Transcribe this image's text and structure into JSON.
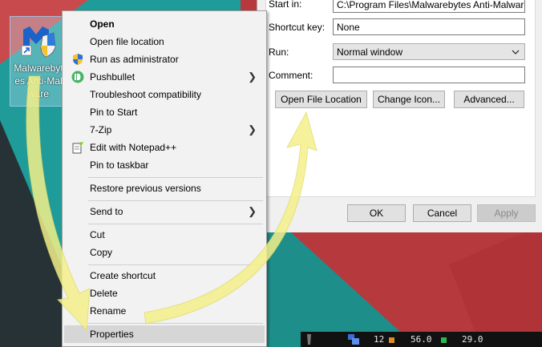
{
  "desktop_icon": {
    "label": "Malwarebytes Anti-Malware",
    "icon": "malwarebytes-shield-icon"
  },
  "context_menu": {
    "items": [
      {
        "label": "Open",
        "bold": true
      },
      {
        "label": "Open file location"
      },
      {
        "label": "Run as administrator",
        "icon": "uac-shield-icon"
      },
      {
        "label": "Pushbullet",
        "icon": "pushbullet-icon",
        "submenu": true
      },
      {
        "label": "Troubleshoot compatibility"
      },
      {
        "label": "Pin to Start"
      },
      {
        "label": "7-Zip",
        "submenu": true
      },
      {
        "label": "Edit with Notepad++",
        "icon": "notepad-plus-plus-icon"
      },
      {
        "label": "Pin to taskbar"
      },
      {
        "label": "Restore previous versions"
      },
      {
        "label": "Send to",
        "submenu": true
      },
      {
        "label": "Cut"
      },
      {
        "label": "Copy"
      },
      {
        "label": "Create shortcut"
      },
      {
        "label": "Delete"
      },
      {
        "label": "Rename"
      },
      {
        "label": "Properties",
        "highlighted": true
      }
    ]
  },
  "dialog": {
    "start_in_label": "Start in:",
    "start_in_value": "C:\\Program Files\\Malwarebytes Anti-Malware",
    "shortcut_key_label": "Shortcut key:",
    "shortcut_key_value": "None",
    "run_label": "Run:",
    "run_value": "Normal window",
    "comment_label": "Comment:",
    "comment_value": "",
    "open_file_location_button": "Open File Location",
    "change_icon_button": "Change Icon...",
    "advanced_button": "Advanced...",
    "ok_button": "OK",
    "cancel_button": "Cancel",
    "apply_button": "Apply"
  },
  "tray": {
    "value1": "12",
    "value2": "56.0",
    "value3": "29.0"
  },
  "colors": {
    "wallpaper_red": "#b83a3e",
    "wallpaper_teal": "#1f9d9a",
    "wallpaper_dark": "#2c3b3e",
    "arrow_yellow": "#f3f08a",
    "menu_highlight": "#d6d6d6"
  }
}
